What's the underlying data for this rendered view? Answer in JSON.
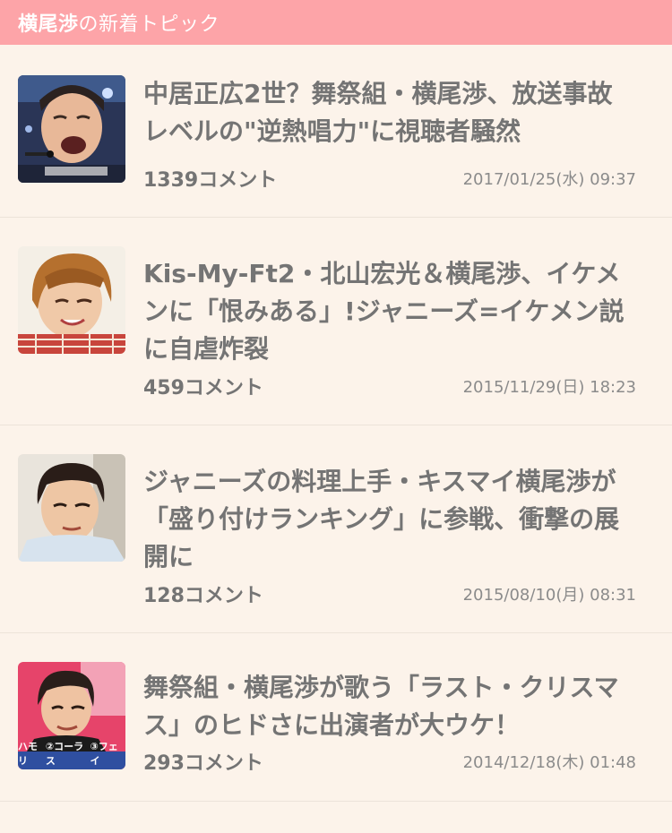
{
  "header": {
    "title_strong": "横尾渉",
    "title_rest": "の新着トピック",
    "bg_color": "#fda4a8"
  },
  "topics": [
    {
      "title": "中居正広2世？舞祭組・横尾渉、放送事故レベルの\"逆熱唱力\"に視聴者騒然",
      "comments": "1339コメント",
      "date": "2017/01/25(水) 09:37"
    },
    {
      "title": "Kis-My-Ft2・北山宏光＆横尾渉、イケメンに「恨みある」!ジャニーズ=イケメン説に自虐炸裂",
      "comments": "459コメント",
      "date": "2015/11/29(日) 18:23"
    },
    {
      "title": "ジャニーズの料理上手・キスマイ横尾渉が「盛り付けランキング」に参戦、衝撃の展開に",
      "comments": "128コメント",
      "date": "2015/08/10(月) 08:31"
    },
    {
      "title": "舞祭組・横尾渉が歌う「ラスト・クリスマス」のヒドさに出演者が大ウケ！",
      "comments": "293コメント",
      "date": "2014/12/18(木) 01:48",
      "thumb_caption": [
        "ハモリ",
        "②コーラス",
        "③フェイ"
      ]
    }
  ]
}
